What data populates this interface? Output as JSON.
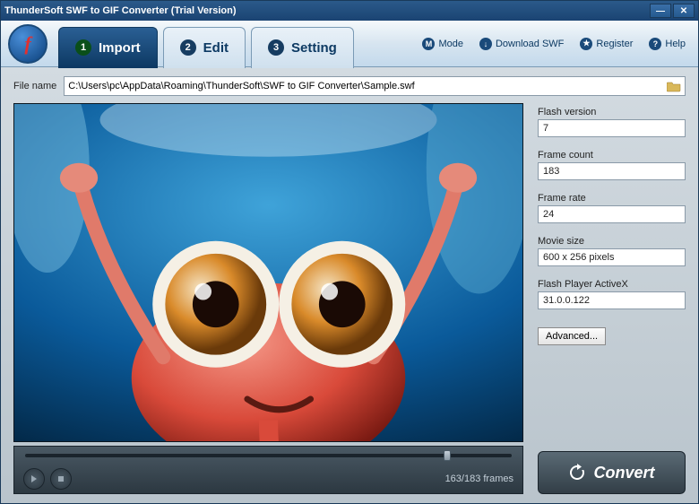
{
  "window": {
    "title": "ThunderSoft SWF to GIF Converter (Trial Version)"
  },
  "tabs": [
    {
      "num": "1",
      "label": "Import"
    },
    {
      "num": "2",
      "label": "Edit"
    },
    {
      "num": "3",
      "label": "Setting"
    }
  ],
  "toolbar_links": {
    "mode": "Mode",
    "download": "Download SWF",
    "register": "Register",
    "help": "Help"
  },
  "file": {
    "label": "File name",
    "value": "C:\\Users\\pc\\AppData\\Roaming\\ThunderSoft\\SWF to GIF Converter\\Sample.swf"
  },
  "player": {
    "frames": "163/183 frames",
    "slider_pct": "86%"
  },
  "info": {
    "flash_version": {
      "label": "Flash version",
      "value": "7"
    },
    "frame_count": {
      "label": "Frame count",
      "value": "183"
    },
    "frame_rate": {
      "label": "Frame rate",
      "value": "24"
    },
    "movie_size": {
      "label": "Movie size",
      "value": "600 x 256 pixels"
    },
    "activex": {
      "label": "Flash Player ActiveX",
      "value": "31.0.0.122"
    }
  },
  "buttons": {
    "advanced": "Advanced...",
    "convert": "Convert"
  }
}
